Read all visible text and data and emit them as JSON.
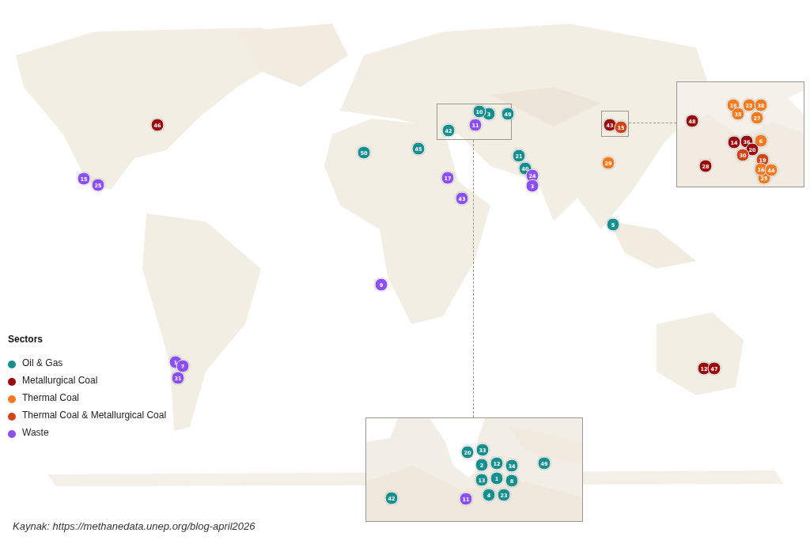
{
  "legend": {
    "title": "Sectors",
    "items": [
      {
        "label": "Oil & Gas",
        "color": "#178f8f"
      },
      {
        "label": "Metallurgical Coal",
        "color": "#9b0b0b"
      },
      {
        "label": "Thermal Coal",
        "color": "#f57a20"
      },
      {
        "label": "Thermal Coal & Metallurgical Coal",
        "color": "#d0461a"
      },
      {
        "label": "Waste",
        "color": "#8b4ff5"
      }
    ]
  },
  "map_markers": [
    {
      "label": "46",
      "color": "#9b0b0b"
    },
    {
      "label": "15",
      "color": "#8b4ff5"
    },
    {
      "label": "25",
      "color": "#8b4ff5"
    },
    {
      "label": "50",
      "color": "#178f8f"
    },
    {
      "label": "45",
      "color": "#178f8f"
    },
    {
      "label": "42",
      "color": "#178f8f"
    },
    {
      "label": "3",
      "color": "#178f8f"
    },
    {
      "label": "10",
      "color": "#178f8f"
    },
    {
      "label": "11",
      "color": "#8b4ff5"
    },
    {
      "label": "49",
      "color": "#178f8f"
    },
    {
      "label": "21",
      "color": "#178f8f"
    },
    {
      "label": "40",
      "color": "#178f8f"
    },
    {
      "label": "24",
      "color": "#8b4ff5"
    },
    {
      "label": "3",
      "color": "#8b4ff5"
    },
    {
      "label": "17",
      "color": "#8b4ff5"
    },
    {
      "label": "43",
      "color": "#8b4ff5"
    },
    {
      "label": "43",
      "color": "#9b0b0b"
    },
    {
      "label": "15",
      "color": "#d0461a"
    },
    {
      "label": "29",
      "color": "#f57a20"
    },
    {
      "label": "5",
      "color": "#178f8f"
    },
    {
      "label": "9",
      "color": "#8b4ff5"
    },
    {
      "label": "1",
      "color": "#8b4ff5"
    },
    {
      "label": "7",
      "color": "#8b4ff5"
    },
    {
      "label": "31",
      "color": "#8b4ff5"
    },
    {
      "label": "12",
      "color": "#9b0b0b"
    },
    {
      "label": "47",
      "color": "#9b0b0b"
    }
  ],
  "inset_east_markers": [
    {
      "label": "48",
      "color": "#9b0b0b"
    },
    {
      "label": "18",
      "color": "#f57a20"
    },
    {
      "label": "22",
      "color": "#f57a20"
    },
    {
      "label": "38",
      "color": "#f57a20"
    },
    {
      "label": "35",
      "color": "#f57a20"
    },
    {
      "label": "27",
      "color": "#f57a20"
    },
    {
      "label": "14",
      "color": "#9b0b0b"
    },
    {
      "label": "36",
      "color": "#9b0b0b"
    },
    {
      "label": "6",
      "color": "#f57a20"
    },
    {
      "label": "20",
      "color": "#9b0b0b"
    },
    {
      "label": "30",
      "color": "#d0461a"
    },
    {
      "label": "19",
      "color": "#d0461a"
    },
    {
      "label": "28",
      "color": "#9b0b0b"
    },
    {
      "label": "25",
      "color": "#f57a20"
    },
    {
      "label": "16",
      "color": "#f57a20"
    },
    {
      "label": "44",
      "color": "#f57a20"
    }
  ],
  "inset_caspian_markers": [
    {
      "label": "20",
      "color": "#178f8f"
    },
    {
      "label": "33",
      "color": "#178f8f"
    },
    {
      "label": "2",
      "color": "#178f8f"
    },
    {
      "label": "12",
      "color": "#178f8f"
    },
    {
      "label": "34",
      "color": "#178f8f"
    },
    {
      "label": "13",
      "color": "#178f8f"
    },
    {
      "label": "1",
      "color": "#178f8f"
    },
    {
      "label": "8",
      "color": "#178f8f"
    },
    {
      "label": "4",
      "color": "#178f8f"
    },
    {
      "label": "23",
      "color": "#178f8f"
    },
    {
      "label": "49",
      "color": "#178f8f"
    },
    {
      "label": "42",
      "color": "#178f8f"
    },
    {
      "label": "11",
      "color": "#8b4ff5"
    }
  ],
  "caption": "Kaynak: https://methanedata.unep.org/blog-april2026"
}
